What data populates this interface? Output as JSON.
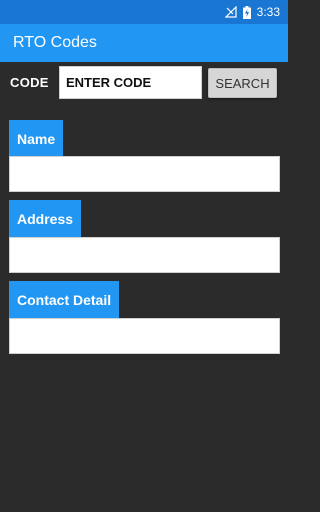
{
  "status_bar": {
    "time": "3:33",
    "icons": [
      "no-signal-icon",
      "battery-charging-icon"
    ],
    "color": "#1976d2"
  },
  "app_bar": {
    "title": "RTO Codes",
    "color": "#2196f3"
  },
  "code_search": {
    "label": "CODE",
    "placeholder": "ENTER CODE",
    "button_label": "SEARCH"
  },
  "fields": {
    "name_label": "Name",
    "address_label": "Address",
    "contact_label": "Contact Detail"
  },
  "colors": {
    "background": "#2b2b2b",
    "accent": "#2196f3"
  }
}
